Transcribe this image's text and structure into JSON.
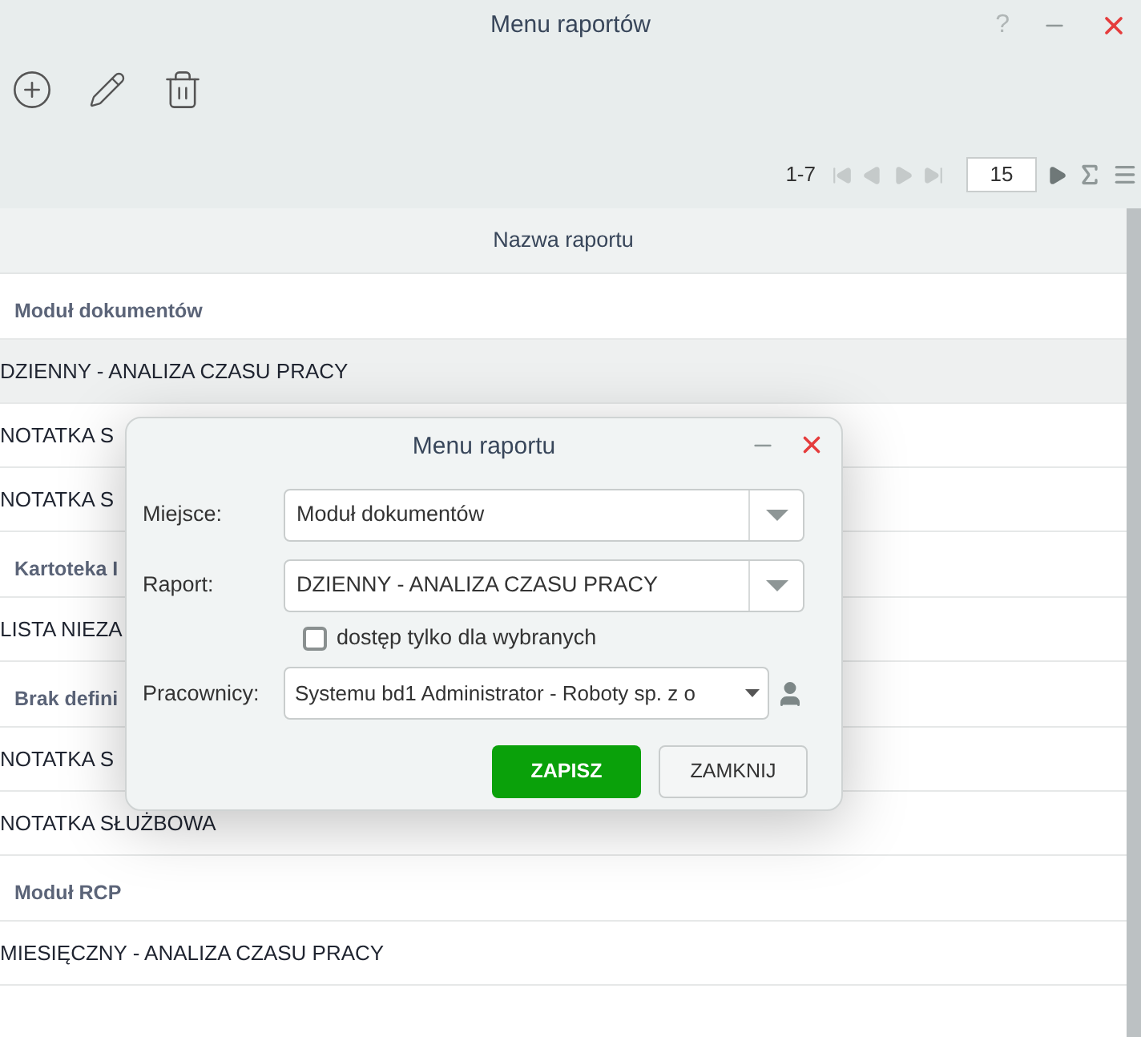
{
  "window": {
    "title": "Menu raportów",
    "help": "?"
  },
  "pager": {
    "range": "1-7",
    "page_size": "15"
  },
  "table": {
    "columns": [
      "Nazwa raportu"
    ],
    "rows": [
      {
        "kind": "group",
        "text": "Moduł dokumentów"
      },
      {
        "kind": "item",
        "text": "DZIENNY - ANALIZA CZASU PRACY",
        "selected": true
      },
      {
        "kind": "item",
        "text": "NOTATKA S",
        "selected": false
      },
      {
        "kind": "item",
        "text": "NOTATKA S",
        "selected": false
      },
      {
        "kind": "group",
        "text": "Kartoteka I"
      },
      {
        "kind": "item",
        "text": "LISTA NIEZA",
        "selected": false
      },
      {
        "kind": "group",
        "text": "Brak defini"
      },
      {
        "kind": "item",
        "text": "NOTATKA S",
        "selected": false
      },
      {
        "kind": "item",
        "text": "NOTATKA SŁUŻBOWA",
        "selected": false
      },
      {
        "kind": "group",
        "text": "Moduł RCP"
      },
      {
        "kind": "item",
        "text": "MIESIĘCZNY - ANALIZA CZASU PRACY",
        "selected": false
      }
    ]
  },
  "dialog": {
    "title": "Menu raportu",
    "place": {
      "label": "Miejsce:",
      "value": "Moduł dokumentów"
    },
    "report": {
      "label": "Raport:",
      "value": "DZIENNY - ANALIZA CZASU PRACY"
    },
    "restricted": {
      "label": "dostęp tylko dla wybranych",
      "checked": false
    },
    "employees": {
      "label": "Pracownicy:",
      "value": "Systemu bd1 Administrator - Roboty sp. z o"
    },
    "buttons": [
      "ZAPISZ",
      "ZAMKNIJ"
    ]
  }
}
